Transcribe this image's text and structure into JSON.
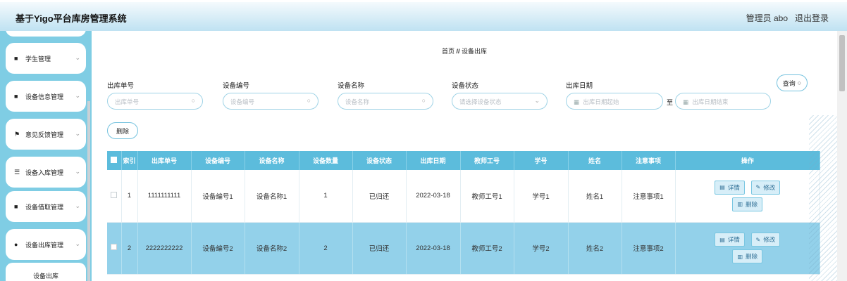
{
  "header": {
    "title": "基于Yigo平台库房管理系统",
    "user": "管理员 abo",
    "logout": "退出登录"
  },
  "sidebar": {
    "items": [
      {
        "label": "学生管理",
        "icon": "grid-icon"
      },
      {
        "label": "设备信息管理",
        "icon": "grid-icon"
      },
      {
        "label": "意见反馈管理",
        "icon": "flag-icon"
      },
      {
        "label": "设备入库管理",
        "icon": "list-icon"
      },
      {
        "label": "设备借取管理",
        "icon": "grid-icon"
      },
      {
        "label": "设备出库管理",
        "icon": "user-icon"
      }
    ],
    "sub_item": "设备出库"
  },
  "breadcrumb": {
    "home": "首页",
    "sep": "//",
    "current": "设备出库"
  },
  "filters": {
    "out_no": {
      "label": "出库单号",
      "placeholder": "出库单号"
    },
    "device_no": {
      "label": "设备编号",
      "placeholder": "设备编号"
    },
    "device_name": {
      "label": "设备名称",
      "placeholder": "设备名称"
    },
    "device_status": {
      "label": "设备状态",
      "placeholder": "请选择设备状态"
    },
    "out_date": {
      "label": "出库日期",
      "start_placeholder": "出库日期起始",
      "to": "至",
      "end_placeholder": "出库日期结束"
    }
  },
  "buttons": {
    "query": "查询",
    "delete": "删除"
  },
  "table": {
    "columns": [
      "索引",
      "出库单号",
      "设备编号",
      "设备名称",
      "设备数量",
      "设备状态",
      "出库日期",
      "教师工号",
      "学号",
      "姓名",
      "注意事项",
      "操作"
    ],
    "rows": [
      [
        "1",
        "1111111111",
        "设备编号1",
        "设备名称1",
        "1",
        "已归还",
        "2022-03-18",
        "教师工号1",
        "学号1",
        "姓名1",
        "注意事项1"
      ],
      [
        "2",
        "2222222222",
        "设备编号2",
        "设备名称2",
        "2",
        "已归还",
        "2022-03-18",
        "教师工号2",
        "学号2",
        "姓名2",
        "注意事项2"
      ]
    ],
    "actions": {
      "detail": "详情",
      "edit": "修改",
      "delete": "删除"
    }
  }
}
